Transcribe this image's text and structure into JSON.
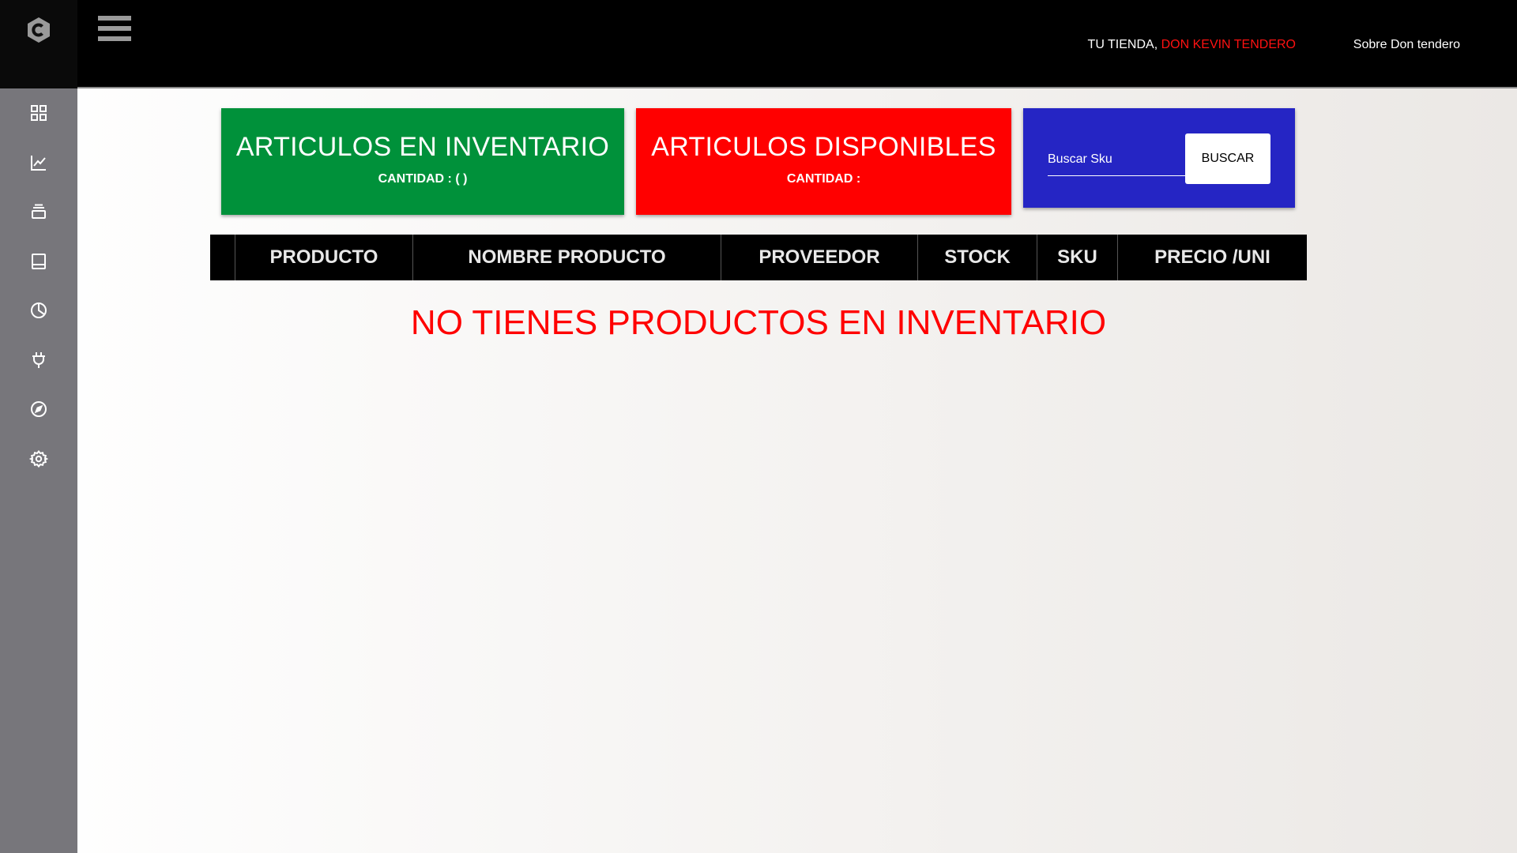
{
  "topbar": {
    "store_prefix": "TU TIENDA, ",
    "store_owner": "DON KEVIN TENDERO",
    "about_link": "Sobre Don tendero"
  },
  "sidebar": {
    "logo_icon": "hexagon-c-logo",
    "items": [
      {
        "icon": "dashboard-grid-icon"
      },
      {
        "icon": "line-chart-icon"
      },
      {
        "icon": "stack-icon"
      },
      {
        "icon": "book-icon"
      },
      {
        "icon": "pie-chart-icon"
      },
      {
        "icon": "plug-icon"
      },
      {
        "icon": "compass-icon"
      },
      {
        "icon": "gear-icon"
      }
    ]
  },
  "cards": {
    "inventory": {
      "title": "ARTICULOS EN INVENTARIO",
      "subtitle": "CANTIDAD : ( )"
    },
    "available": {
      "title": "ARTICULOS DISPONIBLES",
      "subtitle": "CANTIDAD :"
    }
  },
  "search": {
    "placeholder": "Buscar Sku",
    "button_label": "BUSCAR"
  },
  "table": {
    "columns": [
      "",
      "PRODUCTO",
      "NOMBRE PRODUCTO",
      "PROVEEDOR",
      "STOCK",
      "SKU",
      "PRECIO /UNI"
    ],
    "rows": [],
    "empty_message": "NO TIENES PRODUCTOS EN INVENTARIO"
  },
  "colors": {
    "topbar": "#000000",
    "sidebar": "#77767b",
    "card_green": "#00913a",
    "card_red": "#ff0000",
    "card_blue": "#2525c4",
    "accent_red": "#ff1111"
  }
}
